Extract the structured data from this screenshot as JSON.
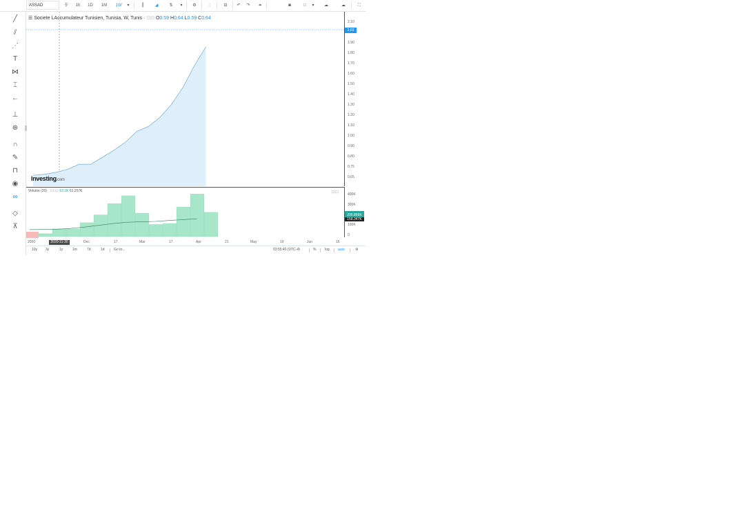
{
  "toolbar": {
    "symbol": "ASSAD",
    "intervals": [
      "5",
      "1h",
      "1D",
      "1M",
      "1W"
    ],
    "active_interval": "1W"
  },
  "legend": {
    "title": "Societe LAccumulateur Tunisien, Tunisia, W, Tunis",
    "o_label": "O",
    "o_value": "0.59",
    "h_label": "H",
    "h_value": "0.64",
    "l_label": "L",
    "l_value": "0.59",
    "c_label": "C",
    "c_value": "0.64"
  },
  "price_axis": {
    "ticks": [
      "2.10",
      "2.03",
      "1.90",
      "1.80",
      "1.70",
      "1.60",
      "1.50",
      "1.40",
      "1.30",
      "1.20",
      "1.10",
      "1.00",
      "0.90",
      "0.80",
      "0.75",
      "0.65"
    ],
    "current_price": "2.03"
  },
  "volume": {
    "legend_label": "Volume (20)",
    "value_a": "63.1K",
    "value_b": "61.257K",
    "axis_ticks": [
      "400K",
      "300K",
      "200K",
      "100K",
      "0"
    ],
    "tag_a": "206.866K",
    "tag_b": "158.347K"
  },
  "time_axis": {
    "labels": [
      "2020",
      "Dec",
      "17",
      "Mar",
      "17",
      "Apr",
      "21",
      "May",
      "19",
      "Jun",
      "15"
    ],
    "cursor_label": "2020-11-30"
  },
  "bottom_bar": {
    "ranges": [
      "10y",
      "3y",
      "1y",
      "1m",
      "7d",
      "1d"
    ],
    "goto": "Go to...",
    "clock": "03:55:40 (UTC-4)",
    "percent": "%",
    "log": "log",
    "auto": "auto"
  },
  "logo": {
    "main": "Investing",
    "suffix": ".com"
  },
  "chart_data": {
    "type": "area",
    "x": [
      "2020-11-09",
      "2020-11-16",
      "2020-11-23",
      "2020-11-30",
      "2020-12-07",
      "2020-12-14",
      "2020-12-21",
      "2020-12-28",
      "2021-01-04",
      "2021-01-11",
      "2021-01-18",
      "2021-01-25",
      "2021-02-01",
      "2021-02-08",
      "2021-02-15",
      "2021-02-22"
    ],
    "y": [
      0.61,
      0.62,
      0.64,
      0.67,
      0.72,
      0.72,
      0.79,
      0.86,
      0.94,
      1.05,
      1.1,
      1.19,
      1.32,
      1.49,
      1.71,
      1.9
    ],
    "volume": [
      35,
      90,
      90,
      160,
      250,
      380,
      470,
      270,
      140,
      150,
      340,
      490,
      280
    ],
    "volume_ma": [
      80,
      82,
      85,
      95,
      110,
      130,
      150,
      165,
      170,
      175,
      185,
      195,
      205
    ],
    "ylim": [
      0.5,
      2.1
    ],
    "volume_ylim": [
      0,
      500
    ],
    "colors": {
      "line": "#7fb6e0",
      "fill": "#deeff9",
      "volume": "#a8e6c9",
      "volume_ma": "#2e7d5b"
    }
  }
}
